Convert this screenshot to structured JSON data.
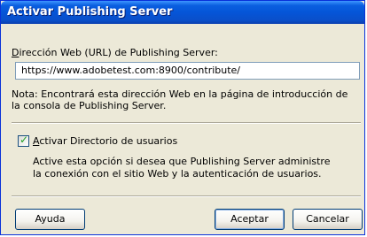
{
  "window": {
    "title": "Activar Publishing Server"
  },
  "form": {
    "url_label_first": "D",
    "url_label_rest": "irección Web (URL) de Publishing Server:",
    "url_value": "https://www.adobetest.com:8900/contribute/",
    "note": "Nota: Encontrará esta dirección Web en la página de introducción de la consola de Publishing Server.",
    "checkbox_checked": true,
    "checkbox_label_first": "A",
    "checkbox_label_rest": "ctivar Directorio de usuarios",
    "description": "Active esta opción si desea que Publishing Server administre la conexión con el sitio Web y la autenticación de usuarios."
  },
  "buttons": {
    "help": "Ayuda",
    "ok": "Aceptar",
    "cancel": "Cancelar"
  }
}
